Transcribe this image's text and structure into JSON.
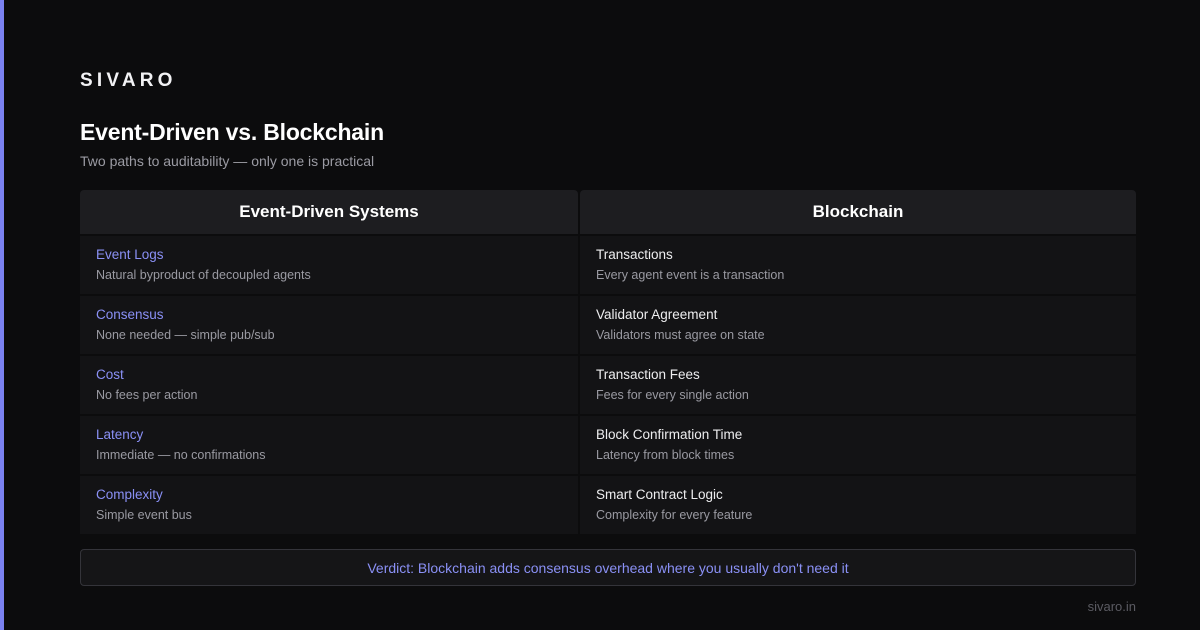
{
  "colors": {
    "background": "#0c0c0d",
    "accent": "#7b82f0",
    "header_bg": "#1d1d20",
    "row_bg": "#131315",
    "muted_text": "#9a9aa2"
  },
  "brand": "SIVARO",
  "title": "Event-Driven vs. Blockchain",
  "subtitle": "Two paths to auditability — only one is practical",
  "comparison": {
    "left": {
      "header": "Event-Driven Systems",
      "rows": [
        {
          "label": "Event Logs",
          "desc": "Natural byproduct of decoupled agents"
        },
        {
          "label": "Consensus",
          "desc": "None needed — simple pub/sub"
        },
        {
          "label": "Cost",
          "desc": "No fees per action"
        },
        {
          "label": "Latency",
          "desc": "Immediate — no confirmations"
        },
        {
          "label": "Complexity",
          "desc": "Simple event bus"
        }
      ]
    },
    "right": {
      "header": "Blockchain",
      "rows": [
        {
          "label": "Transactions",
          "desc": "Every agent event is a transaction"
        },
        {
          "label": "Validator Agreement",
          "desc": "Validators must agree on state"
        },
        {
          "label": "Transaction Fees",
          "desc": "Fees for every single action"
        },
        {
          "label": "Block Confirmation Time",
          "desc": "Latency from block times"
        },
        {
          "label": "Smart Contract Logic",
          "desc": "Complexity for every feature"
        }
      ]
    }
  },
  "verdict": "Verdict: Blockchain adds consensus overhead where you usually don't need it",
  "footer": "sivaro.in"
}
